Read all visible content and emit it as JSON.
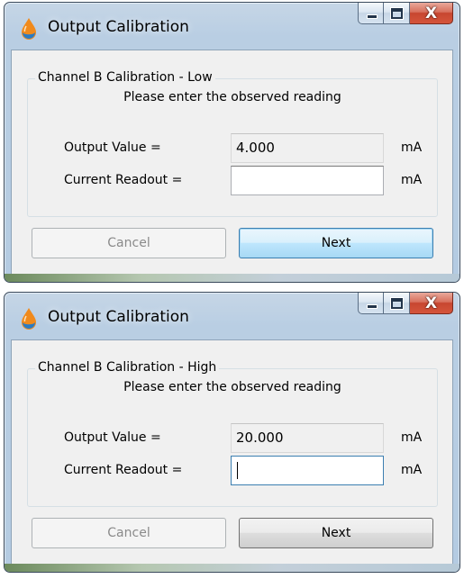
{
  "windows": [
    {
      "title": "Output Calibration",
      "group_label": "Channel B Calibration - Low",
      "prompt": "Please enter the observed reading",
      "output_value_label": "Output Value =",
      "output_value": "4.000",
      "output_unit": "mA",
      "current_readout_label": "Current Readout =",
      "current_readout_value": "",
      "current_unit": "mA",
      "cancel_label": "Cancel",
      "next_label": "Next",
      "close_glyph": "X"
    },
    {
      "title": "Output Calibration",
      "group_label": "Channel B Calibration - High",
      "prompt": "Please enter the observed reading",
      "output_value_label": "Output Value =",
      "output_value": "20.000",
      "output_unit": "mA",
      "current_readout_label": "Current Readout =",
      "current_readout_value": "",
      "current_unit": "mA",
      "cancel_label": "Cancel",
      "next_label": "Next",
      "close_glyph": "X"
    }
  ],
  "icons": {
    "app": "water-drop-icon",
    "minimize": "minimize-icon",
    "maximize": "maximize-icon",
    "close": "close-icon"
  },
  "colors": {
    "frame": "#b4cbe2",
    "client": "#f0f0f0",
    "close_button": "#c74630",
    "focus_border": "#3c7fb1",
    "app_icon_orange": "#f08a1c",
    "app_icon_blue": "#2b7bc2"
  }
}
